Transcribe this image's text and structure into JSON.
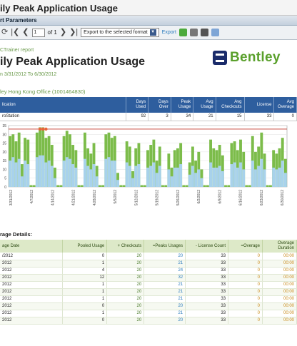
{
  "window": {
    "title": "ily Peak Application Usage"
  },
  "params_bar": {
    "label": "rt Parameters"
  },
  "toolbar": {
    "page_current": "1",
    "page_of": "of 1",
    "export_select": "Export to the selected format",
    "export_link": "Export"
  },
  "report": {
    "tag": "CTrainer report",
    "title": "ily Peak Application Usage",
    "range": "n 3/31/2012 To 6/30/2012",
    "logo_text": "Bentley",
    "office": "ley Hong Kong Office (1001464830)"
  },
  "summary_table": {
    "headers": [
      "lication",
      "Days Used",
      "Days Over",
      "Peak Usage",
      "Avg Usage",
      "Avg Checkouts",
      "License",
      "Avg Overage"
    ],
    "row": [
      "roStation",
      "92",
      "3",
      "34",
      "21",
      "15",
      "33",
      "0"
    ]
  },
  "chart_data": {
    "type": "bar",
    "title": "",
    "xlabel": "",
    "ylabel": "",
    "ylim": [
      0,
      35
    ],
    "yticks": [
      "35",
      "30",
      "25",
      "20",
      "15",
      "10",
      "5",
      "0"
    ],
    "license_line": 33,
    "x_tick_labels": [
      "3/31/2012",
      "4/7/2012",
      "4/14/2012",
      "4/21/2012",
      "4/28/2012",
      "5/5/2012",
      "5/12/2012",
      "5/19/2012",
      "5/26/2012",
      "6/2/2012",
      "6/9/2012",
      "6/16/2012",
      "6/23/2012",
      "6/30/2012"
    ],
    "series": [
      {
        "name": "Peak Usage",
        "color": "#7cbc4a",
        "values": [
          29,
          30,
          26,
          31,
          13,
          28,
          27,
          1,
          1,
          31,
          34,
          34,
          28,
          29,
          24,
          11,
          1,
          1,
          29,
          32,
          30,
          24,
          21,
          1,
          1,
          31,
          22,
          19,
          25,
          12,
          1,
          1,
          30,
          31,
          28,
          29,
          8,
          1,
          1,
          26,
          23,
          9,
          22,
          25,
          1,
          1,
          21,
          24,
          27,
          15,
          23,
          1,
          1,
          19,
          11,
          21,
          22,
          25,
          1,
          1,
          14,
          23,
          15,
          20,
          10,
          1,
          1,
          27,
          22,
          21,
          24,
          18,
          1,
          1,
          25,
          26,
          21,
          27,
          20,
          1,
          1,
          29,
          20,
          23,
          31,
          19,
          1,
          1,
          21,
          19,
          22,
          28,
          16
        ]
      },
      {
        "name": "Avg Usage",
        "color": "#a8d2ec",
        "values": [
          15,
          17,
          14,
          16,
          6,
          15,
          13,
          0,
          0,
          17,
          18,
          18,
          14,
          15,
          12,
          5,
          0,
          0,
          15,
          17,
          16,
          13,
          11,
          0,
          0,
          16,
          12,
          10,
          13,
          6,
          0,
          0,
          16,
          17,
          15,
          15,
          4,
          0,
          0,
          14,
          12,
          5,
          12,
          13,
          0,
          0,
          11,
          12,
          14,
          8,
          12,
          0,
          0,
          10,
          6,
          11,
          11,
          13,
          0,
          0,
          7,
          12,
          8,
          10,
          5,
          0,
          0,
          14,
          11,
          11,
          12,
          9,
          0,
          0,
          13,
          14,
          11,
          14,
          10,
          0,
          0,
          15,
          10,
          12,
          16,
          10,
          0,
          0,
          11,
          10,
          11,
          15,
          8
        ]
      }
    ],
    "overage_markers": [
      10,
      11,
      12
    ]
  },
  "details": {
    "label": "rage Details:",
    "headers": [
      "age Date",
      "Pooled Usage",
      "+ Checkouts",
      "=Peaks Usages",
      "- License Count",
      "=Overage",
      "Overage Duration"
    ],
    "rows": [
      [
        "/2012",
        "0",
        "20",
        "20",
        "33",
        "0",
        "00:00"
      ],
      [
        "2012",
        "1",
        "20",
        "21",
        "33",
        "0",
        "00:00"
      ],
      [
        "2012",
        "4",
        "20",
        "24",
        "33",
        "0",
        "00:00"
      ],
      [
        "2012",
        "12",
        "20",
        "32",
        "33",
        "0",
        "00:00"
      ],
      [
        "2012",
        "1",
        "20",
        "21",
        "33",
        "0",
        "00:00"
      ],
      [
        "2012",
        "1",
        "20",
        "21",
        "33",
        "0",
        "00:00"
      ],
      [
        "2012",
        "1",
        "20",
        "21",
        "33",
        "0",
        "00:00"
      ],
      [
        "2012",
        "0",
        "20",
        "20",
        "33",
        "0",
        "00:00"
      ],
      [
        "2012",
        "1",
        "20",
        "21",
        "33",
        "0",
        "00:00"
      ],
      [
        "2012",
        "0",
        "20",
        "20",
        "33",
        "0",
        "00:00"
      ]
    ]
  },
  "colors": {
    "accent_blue": "#2e5e9e",
    "bentley_green": "#5aa02c",
    "license_line": "#c0392b",
    "overage_marker": "#e8643a"
  }
}
